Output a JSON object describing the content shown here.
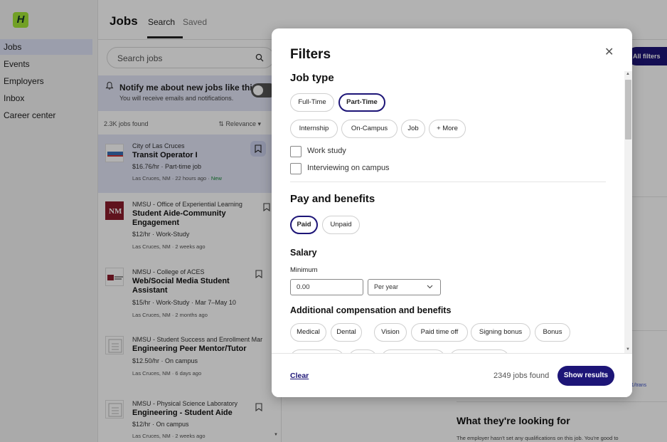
{
  "app": {
    "logo": "H"
  },
  "nav": [
    {
      "label": "Jobs"
    },
    {
      "label": "Events"
    },
    {
      "label": "Employers"
    },
    {
      "label": "Inbox"
    },
    {
      "label": "Career center"
    }
  ],
  "header": {
    "title": "Jobs",
    "tabs": [
      "Search",
      "Saved"
    ]
  },
  "search": {
    "placeholder": "Search jobs"
  },
  "notify": {
    "title": "Notify me about new jobs like this",
    "subtitle": "You will receive emails and notifications."
  },
  "results": {
    "count": "2.3K jobs found",
    "sort": "Relevance"
  },
  "jobs": [
    {
      "employer": "City of Las Cruces",
      "title": "Transit Operator I",
      "pay": "$16.76/hr · Part-time job",
      "location": "Las Cruces, NM · 22 hours ago · ",
      "new": "New"
    },
    {
      "employer": "NMSU - Office of Experiential Learning",
      "title": "Student Aide-Community Engagement",
      "pay": "$12/hr · Work-Study",
      "location": "Las Cruces, NM · 2 weeks ago"
    },
    {
      "employer": "NMSU - College of ACES",
      "title": "Web/Social Media Student Assistant",
      "pay": "$15/hr · Work-Study · Mar 7–May 10",
      "location": "Las Cruces, NM · 2 months ago"
    },
    {
      "employer": "NMSU - Student Success and Enrollment Mar",
      "title": "Engineering Peer Mentor/Tutor",
      "pay": "$12.50/hr · On campus",
      "location": "Las Cruces, NM · 6 days ago"
    },
    {
      "employer": "NMSU - Physical Science Laboratory",
      "title": "Engineering - Student Aide",
      "pay": "$12/hr · On campus",
      "location": "Las Cruces, NM · 2 weeks ago"
    }
  ],
  "detail": {
    "all_filters": "All filters",
    "link_fragment": "341/trans",
    "looking_title": "What they're looking for",
    "looking_text": "The employer hasn't set any qualifications on this job. You're good to"
  },
  "modal": {
    "title": "Filters",
    "job_type": {
      "heading": "Job type",
      "chips_row1": [
        "Full-Time",
        "Part-Time"
      ],
      "chips_row2": [
        "Internship",
        "On-Campus",
        "Job",
        "+ More"
      ],
      "selected": "Part-Time",
      "checkboxes": [
        "Work study",
        "Interviewing on campus"
      ]
    },
    "pay": {
      "heading": "Pay and benefits",
      "chips": [
        "Paid",
        "Unpaid"
      ],
      "selected": "Paid",
      "salary_heading": "Salary",
      "minimum_label": "Minimum",
      "minimum_value": "0.00",
      "period": "Per year",
      "comp_heading": "Additional compensation and benefits",
      "benefits": [
        "Medical",
        "Dental",
        "Vision",
        "Paid time off",
        "Signing bonus",
        "Bonus"
      ]
    },
    "footer": {
      "clear": "Clear",
      "found": "2349 jobs found",
      "show": "Show results"
    }
  },
  "colors": {
    "accent": "#1d1577",
    "logo_green": "#a3e635",
    "selected_card": "#e3e5f7"
  }
}
